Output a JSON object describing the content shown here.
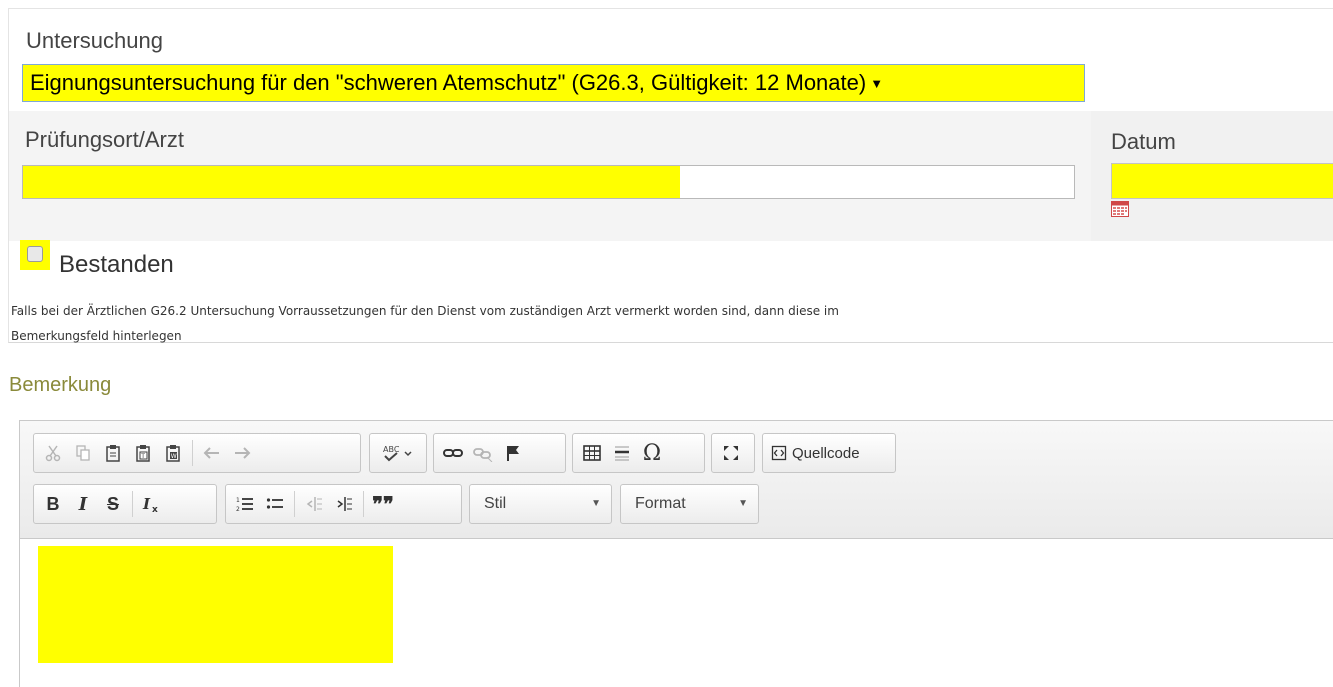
{
  "form": {
    "untersuchung_label": "Untersuchung",
    "untersuchung_value": "Eignungsuntersuchung für den \"schweren Atemschutz\" (G26.3, Gültigkeit: 12 Monate)",
    "pruefungsort_label": "Prüfungsort/Arzt",
    "pruefungsort_value": "",
    "datum_label": "Datum",
    "datum_value": "",
    "bestanden_label": "Bestanden",
    "bestanden_checked": false,
    "hint_line1": "Falls bei der Ärztlichen G26.2 Untersuchung Vorraussetzungen für den Dienst vom zuständigen Arzt vermerkt worden sind, dann diese im",
    "hint_line2": "Bemerkungsfeld hinterlegen",
    "bemerkung_label": "Bemerkung"
  },
  "editor": {
    "toolbar_row1": {
      "clipboard": [
        "cut-icon",
        "copy-icon",
        "paste-icon",
        "paste-text-icon",
        "paste-word-icon",
        "undo-icon",
        "redo-icon"
      ],
      "spellcheck": "spellcheck-icon",
      "links": [
        "link-icon",
        "unlink-icon",
        "anchor-icon"
      ],
      "insert": [
        "table-icon",
        "horizontal-line-icon",
        "special-char-icon"
      ],
      "maximize": "maximize-icon",
      "source_label": "Quellcode"
    },
    "toolbar_row2": {
      "bold": "B",
      "italic": "I",
      "strike": "S",
      "remove_format": "Tx",
      "blockquote": "99",
      "stil_label": "Stil",
      "format_label": "Format"
    },
    "content": ""
  },
  "colors": {
    "highlight": "#ffff00",
    "label_text": "#444444",
    "bemerkung_label": "#8a8a3a",
    "select_border": "#7fa8d6"
  },
  "pruefungsort_fill_fraction": 0.625
}
